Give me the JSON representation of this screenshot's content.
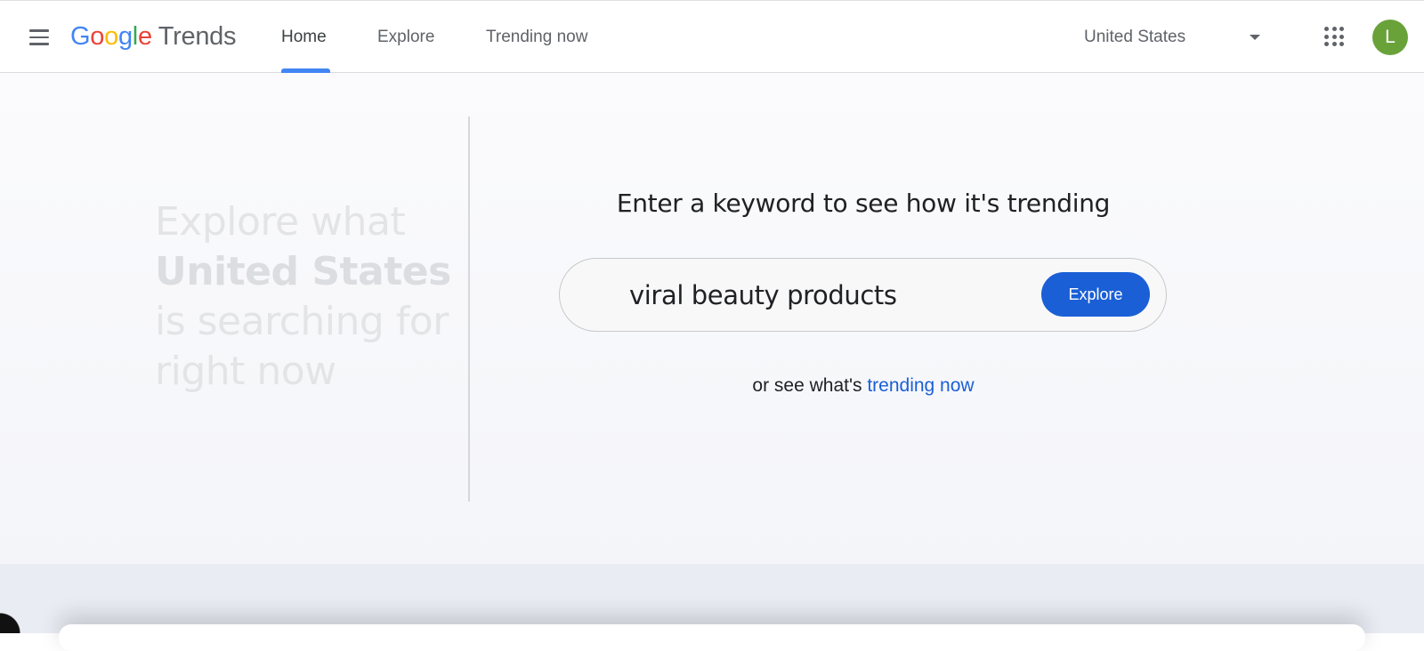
{
  "header": {
    "logo": {
      "g1": "G",
      "o1": "o",
      "o2": "o",
      "g2": "g",
      "l": "l",
      "e": "e",
      "product": "Trends"
    },
    "tabs": [
      {
        "label": "Home",
        "active": true
      },
      {
        "label": "Explore",
        "active": false
      },
      {
        "label": "Trending now",
        "active": false
      }
    ],
    "region": {
      "label": "United States",
      "icon": "caret-down-icon"
    },
    "apps_icon": "apps-grid-icon",
    "avatar_initial": "L"
  },
  "hero": {
    "line1": "Explore what",
    "line2": "United States",
    "line3": "is searching for",
    "line4": "right now"
  },
  "search": {
    "prompt": "Enter a keyword to see how it's trending",
    "value": "viral beauty products",
    "button_label": "Explore",
    "alt_prefix": "or see what's",
    "alt_link": "trending now"
  },
  "colors": {
    "brand_blue": "#4285f4",
    "button_blue": "#1a5fd6",
    "avatar_green": "#6aa23a"
  }
}
